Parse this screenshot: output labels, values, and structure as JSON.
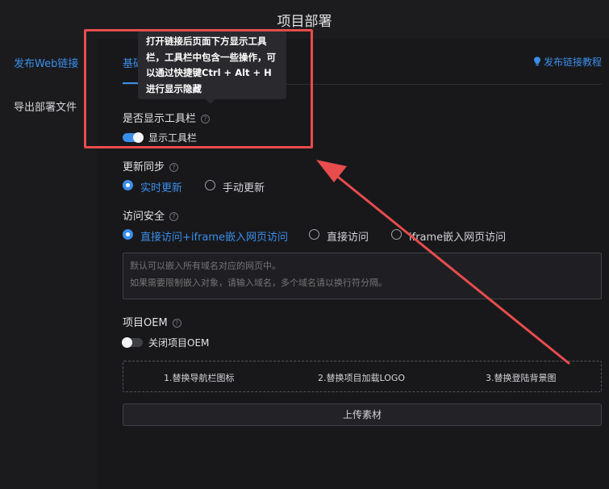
{
  "header": {
    "title": "项目部署"
  },
  "sidebar": {
    "items": [
      {
        "label": "发布Web链接",
        "active": true
      },
      {
        "label": "导出部署文件",
        "active": false
      }
    ]
  },
  "main": {
    "tab_label": "基础",
    "tutorial_label": "发布链接教程",
    "tooltip_text": "打开链接后页面下方显示工具栏，工具栏中包含一些操作，可以通过快捷键Ctrl + Alt + H进行显示隐藏"
  },
  "toolbar_section": {
    "label": "是否显示工具栏",
    "toggle_label": "显示工具栏",
    "toggle_on": true
  },
  "sync_section": {
    "label": "更新同步",
    "options": [
      "实时更新",
      "手动更新"
    ],
    "selected": "实时更新"
  },
  "security_section": {
    "label": "访问安全",
    "options": [
      "直接访问+iframe嵌入网页访问",
      "直接访问",
      "iframe嵌入网页访问"
    ],
    "selected": "直接访问+iframe嵌入网页访问",
    "textarea_placeholder": "默认可以嵌入所有域名对应的网页中。\n如果需要限制嵌入对象，请输入域名，多个域名请以换行符分隔。"
  },
  "oem_section": {
    "label": "项目OEM",
    "toggle_label": "关闭项目OEM",
    "toggle_on": false,
    "items": [
      "1.替换导航栏图标",
      "2.替换项目加载LOGO",
      "3.替换登陆背景图"
    ],
    "upload_label": "上传素材"
  },
  "colors": {
    "accent": "#3b8eea",
    "annotation": "#e84c4c"
  }
}
